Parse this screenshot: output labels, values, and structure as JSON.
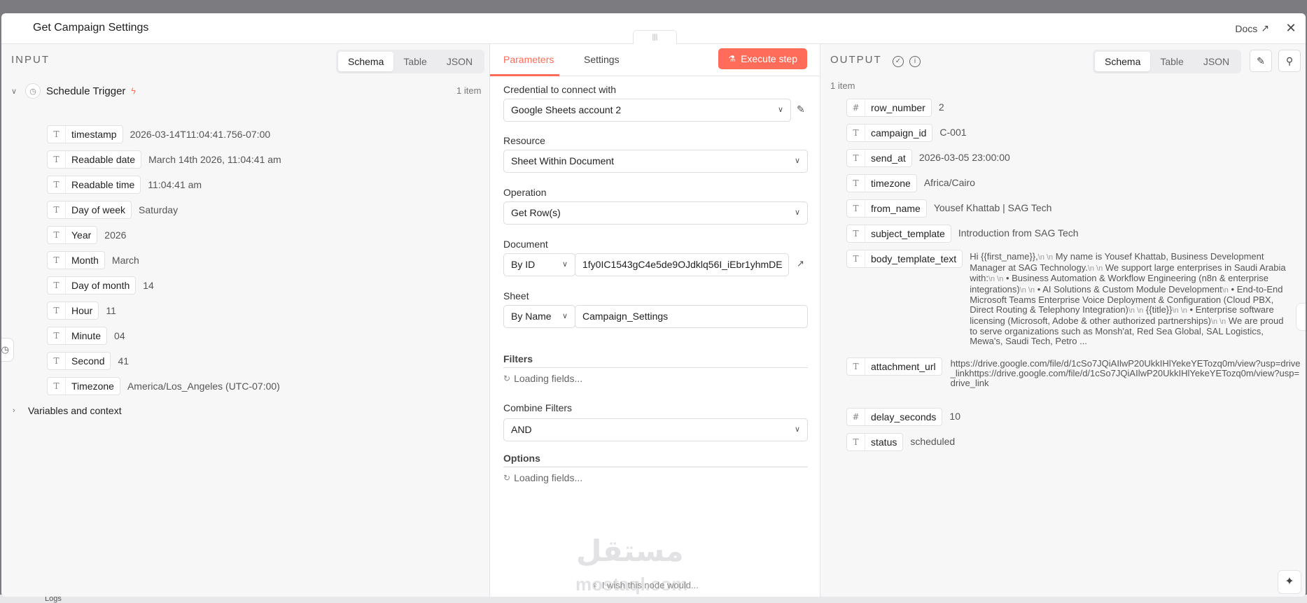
{
  "modal": {
    "title": "Get Campaign Settings",
    "docs_label": "Docs",
    "close_glyph": "✕",
    "drag_glyph": "|||"
  },
  "input": {
    "label": "INPUT",
    "view_tabs": [
      "Schema",
      "Table",
      "JSON"
    ],
    "active_view": "Schema",
    "root_node": "Schedule Trigger",
    "item_count": "1 item",
    "fields": [
      {
        "key": "timestamp",
        "value": "2026-03-14T11:04:41.756-07:00"
      },
      {
        "key": "Readable date",
        "value": "March 14th 2026, 11:04:41 am"
      },
      {
        "key": "Readable time",
        "value": "11:04:41 am"
      },
      {
        "key": "Day of week",
        "value": "Saturday"
      },
      {
        "key": "Year",
        "value": "2026"
      },
      {
        "key": "Month",
        "value": "March"
      },
      {
        "key": "Day of month",
        "value": "14"
      },
      {
        "key": "Hour",
        "value": "11"
      },
      {
        "key": "Minute",
        "value": "04"
      },
      {
        "key": "Second",
        "value": "41"
      },
      {
        "key": "Timezone",
        "value": "America/Los_Angeles (UTC-07:00)"
      }
    ],
    "variables_label": "Variables and context"
  },
  "params": {
    "tabs": [
      "Parameters",
      "Settings"
    ],
    "execute_label": "Execute step",
    "credential_label": "Credential to connect with",
    "credential_value": "Google Sheets account 2",
    "resource_label": "Resource",
    "resource_value": "Sheet Within Document",
    "operation_label": "Operation",
    "operation_value": "Get Row(s)",
    "document_label": "Document",
    "document_mode": "By ID",
    "document_value": "1fy0IC1543gC4e5de9OJdklq56I_iEbr1yhmDE",
    "sheet_label": "Sheet",
    "sheet_mode": "By Name",
    "sheet_value": "Campaign_Settings",
    "filters_label": "Filters",
    "loading_text": "Loading fields...",
    "combine_label": "Combine Filters",
    "combine_value": "AND",
    "options_label": "Options",
    "wish_text": "I wish this node would...",
    "watermark": "مستقل",
    "watermark_latin": "mostaql.com"
  },
  "output": {
    "label": "OUTPUT",
    "view_tabs": [
      "Schema",
      "Table",
      "JSON"
    ],
    "active_view": "Schema",
    "item_count": "1 item",
    "fields": [
      {
        "key": "row_number",
        "type": "#",
        "value": "2"
      },
      {
        "key": "campaign_id",
        "type": "T",
        "value": "C-001"
      },
      {
        "key": "send_at",
        "type": "T",
        "value": "2026-03-05 23:00:00"
      },
      {
        "key": "timezone",
        "type": "T",
        "value": "Africa/Cairo"
      },
      {
        "key": "from_name",
        "type": "T",
        "value": "Yousef Khattab | SAG Tech"
      },
      {
        "key": "subject_template",
        "type": "T",
        "value": "Introduction from SAG Tech"
      }
    ],
    "body_key": "body_template_text",
    "body_parts": [
      "Hi {{first_name}},",
      "\\n \\n",
      " My name is Yousef Khattab, Business Development Manager at SAG Technology.",
      "\\n \\n",
      " We support large enterprises in Saudi Arabia with:",
      "\\n \\n",
      " • Business Automation & Workflow Engineering (n8n & enterprise integrations)",
      "\\n \\n",
      " • AI Solutions & Custom Module Development",
      "\\n",
      " • End-to-End Microsoft Teams Enterprise Voice Deployment & Configuration (Cloud PBX, Direct Routing & Telephony Integration)",
      "\\n \\n",
      " {{title}}",
      "\\n \\n",
      " • Enterprise software licensing (Microsoft, Adobe & other authorized partnerships)",
      "\\n \\n",
      " We are proud to serve organizations such as Monsh'at, Red Sea Global, SAL Logistics, Mewa's, Saudi Tech, Petro ..."
    ],
    "attachment_key": "attachment_url",
    "attachment_value": "https://drive.google.com/file/d/1cSo7JQiAIlwP20UkkIHlYekeYETozq0m/view?usp=drive_linkhttps://drive.google.com/file/d/1cSo7JQiAIlwP20UkkIHlYekeYETozq0m/view?usp=drive_link",
    "tail_fields": [
      {
        "key": "delay_seconds",
        "type": "#",
        "value": "10"
      },
      {
        "key": "status",
        "type": "T",
        "value": "scheduled"
      }
    ]
  },
  "backdrop_text": "Logs",
  "accent_color": "#ff6d5a"
}
